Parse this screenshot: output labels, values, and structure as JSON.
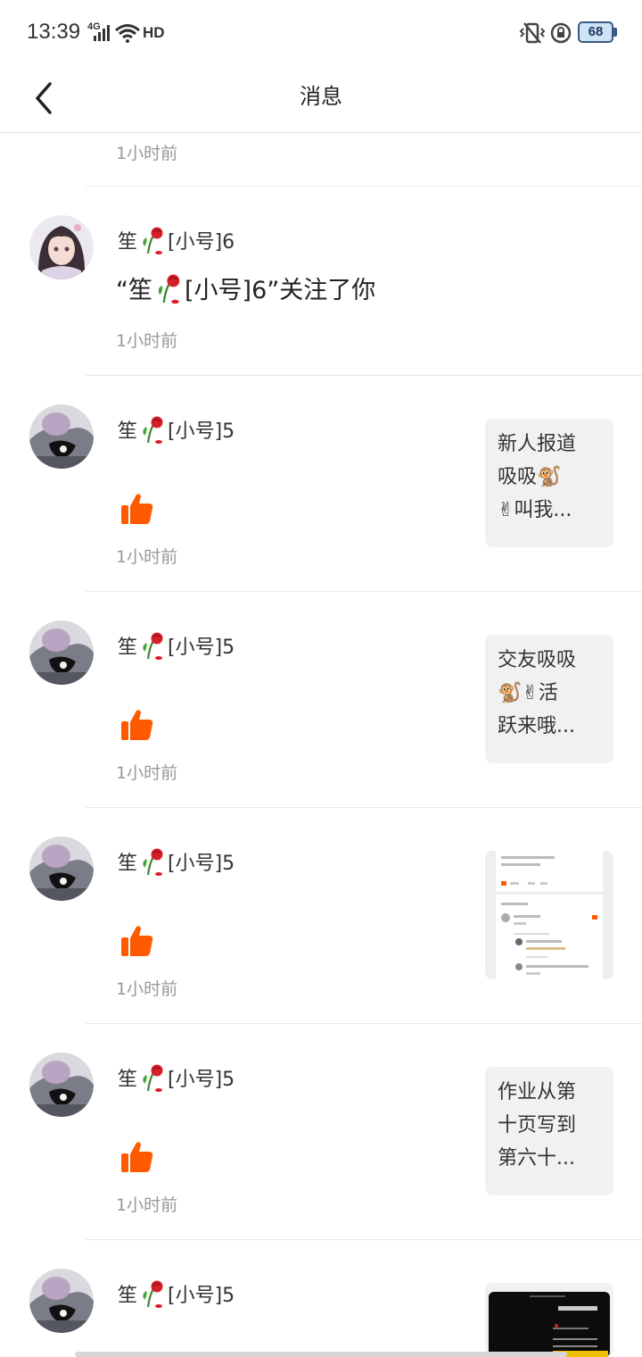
{
  "status_bar": {
    "time": "13:39",
    "network": "4G",
    "hd": "HD",
    "battery": "68",
    "icons": [
      "signal-icon",
      "wifi-icon",
      "vibrate-icon",
      "rotation-lock-icon",
      "battery-icon"
    ]
  },
  "header": {
    "title": "消息",
    "back_icon": "chevron-left-icon"
  },
  "top_time": "1小时前",
  "notifications": [
    {
      "user_prefix": "笙",
      "user_suffix": "[小号]6",
      "message_open": "“笙",
      "message_close": "[小号]6”关注了你",
      "type": "follow",
      "time": "1小时前"
    },
    {
      "user_prefix": "笙",
      "user_suffix": "[小号]5",
      "type": "like",
      "time": "1小时前",
      "thumb_lines": [
        "新人报道",
        "吸吸🐒",
        "✌叫我..."
      ]
    },
    {
      "user_prefix": "笙",
      "user_suffix": "[小号]5",
      "type": "like",
      "time": "1小时前",
      "thumb_lines": [
        "交友吸吸",
        "🐒✌活",
        "跃来哦..."
      ]
    },
    {
      "user_prefix": "笙",
      "user_suffix": "[小号]5",
      "type": "like",
      "time": "1小时前",
      "thumb_image": "screenshot-thumbnail"
    },
    {
      "user_prefix": "笙",
      "user_suffix": "[小号]5",
      "type": "like",
      "time": "1小时前",
      "thumb_lines": [
        "作业从第",
        "十页写到",
        "第六十..."
      ]
    },
    {
      "user_prefix": "笙",
      "user_suffix": "[小号]5",
      "type": "like",
      "thumb_image": "dark-video-thumbnail"
    }
  ],
  "colors": {
    "like": "#ff5a00",
    "time": "#999999",
    "thumb_bg": "#f1f1f1",
    "divider": "#e8e8e8"
  }
}
